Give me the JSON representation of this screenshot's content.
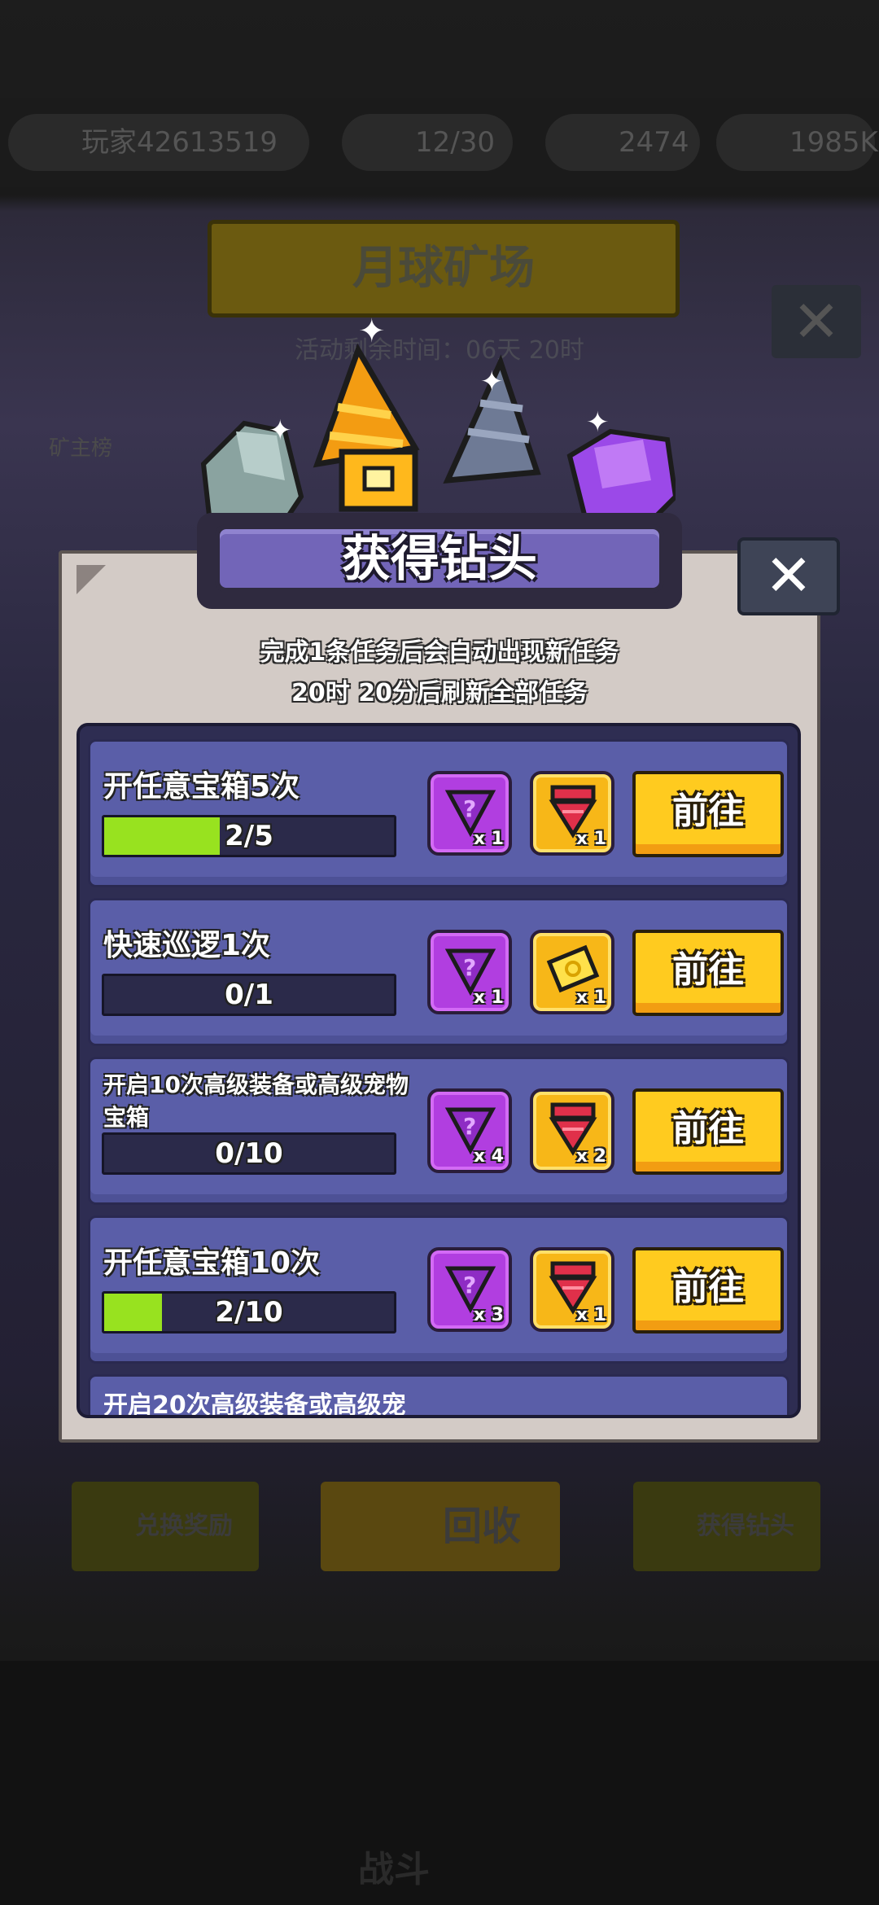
{
  "background": {
    "player_name": "玩家42613519",
    "stamina": "12/30",
    "coins": "2474",
    "gold": "1985K",
    "mine_title": "月球矿场",
    "timer": "活动剩余时间：06天 20时",
    "leaderboard": "矿主榜",
    "exchange_label": "兑换奖励",
    "recycle_label": "回收",
    "get_drill_label": "获得钻头",
    "fight_label": "战斗"
  },
  "dialog": {
    "title": "获得钻头",
    "subtitle_1": "完成1条任务后会自动出现新任务",
    "subtitle_2": "20时 20分后刷新全部任务",
    "go_label": "前往"
  },
  "tasks": [
    {
      "name": "开任意宝箱5次",
      "progress_text": "2/5",
      "progress": 0.4,
      "reward_1_qty": "x 1",
      "reward_2_qty": "x 1",
      "reward_2_icon": "red-drill-icon"
    },
    {
      "name": "快速巡逻1次",
      "progress_text": "0/1",
      "progress": 0,
      "reward_1_qty": "x 1",
      "reward_2_qty": "x 1",
      "reward_2_icon": "ticket-icon"
    },
    {
      "name": "开启10次高级装备或高级宠物宝箱",
      "progress_text": "0/10",
      "progress": 0,
      "reward_1_qty": "x 4",
      "reward_2_qty": "x 2",
      "reward_2_icon": "red-drill-icon"
    },
    {
      "name": "开任意宝箱10次",
      "progress_text": "2/10",
      "progress": 0.2,
      "reward_1_qty": "x 3",
      "reward_2_qty": "x 1",
      "reward_2_icon": "red-drill-icon"
    }
  ],
  "peek_task": "开启20次高级装备或高级宠",
  "colors": {
    "progress_fill": "#98e21f",
    "go_button": "#ffcb1f",
    "purple_reward": "#b13ee0",
    "gold_reward": "#f7b718"
  }
}
